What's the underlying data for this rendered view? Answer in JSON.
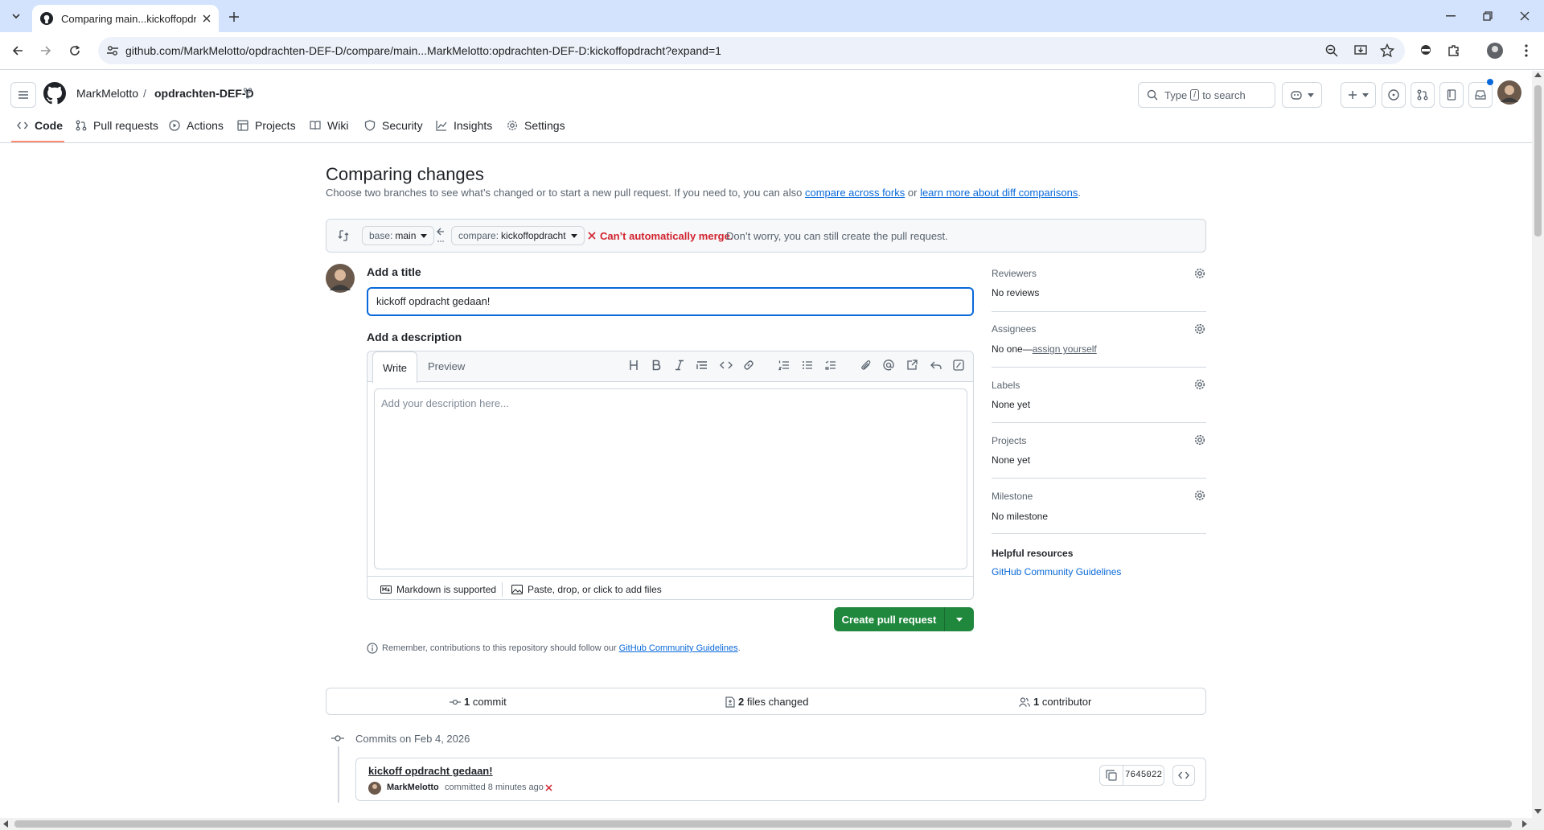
{
  "browser": {
    "tab_title": "Comparing main...kickoffopdracht",
    "url": "github.com/MarkMelotto/opdrachten-DEF-D/compare/main...MarkMelotto:opdrachten-DEF-D:kickoffopdracht?expand=1"
  },
  "header": {
    "owner": "MarkMelotto",
    "separator": "/",
    "repo": "opdrachten-DEF-D",
    "search_prefix": "Type",
    "search_key": "/",
    "search_suffix": "to search"
  },
  "repo_nav": {
    "code": "Code",
    "pulls": "Pull requests",
    "actions": "Actions",
    "projects": "Projects",
    "wiki": "Wiki",
    "security": "Security",
    "insights": "Insights",
    "settings": "Settings"
  },
  "compare": {
    "title": "Comparing changes",
    "desc_before": "Choose two branches to see what’s changed or to start a new pull request. If you need to, you can also",
    "link_forks": "compare across forks",
    "desc_or": "or",
    "link_learn": "learn more about diff comparisons",
    "desc_end": ".",
    "base_label": "base:",
    "base_value": "main",
    "compare_label": "compare:",
    "compare_value": "kickoffopdracht",
    "merge_status": "Can’t automatically merge.",
    "merge_note": "Don’t worry, you can still create the pull request."
  },
  "form": {
    "title_label": "Add a title",
    "title_value": "kickoff opdracht gedaan!",
    "desc_label": "Add a description",
    "tab_write": "Write",
    "tab_preview": "Preview",
    "desc_placeholder": "Add your description here...",
    "markdown_note": "Markdown is supported",
    "attach_note": "Paste, drop, or click to add files",
    "create_button": "Create pull request",
    "remember_before": "Remember, contributions to this repository should follow our",
    "remember_link": "GitHub Community Guidelines",
    "remember_end": "."
  },
  "sidebar": {
    "reviewers_label": "Reviewers",
    "reviewers_value": "No reviews",
    "assignees_label": "Assignees",
    "assignees_value": "No one—",
    "assign_yourself": "assign yourself",
    "labels_label": "Labels",
    "labels_value": "None yet",
    "projects_label": "Projects",
    "projects_value": "None yet",
    "milestone_label": "Milestone",
    "milestone_value": "No milestone",
    "helpful_title": "Helpful resources",
    "helpful_link": "GitHub Community Guidelines"
  },
  "stats": {
    "commits_count": "1",
    "commits_label": "commit",
    "files_count": "2",
    "files_label": "files changed",
    "contrib_count": "1",
    "contrib_label": "contributor"
  },
  "commits": {
    "date_header": "Commits on Feb 4, 2026",
    "message": "kickoff opdracht gedaan!",
    "author": "MarkMelotto",
    "meta": "committed 8 minutes ago",
    "sha": "7645022"
  },
  "colors": {
    "accent": "#0969da",
    "green": "#1f883d",
    "danger": "#d1242f",
    "underline_nav": "#fd8c73"
  }
}
